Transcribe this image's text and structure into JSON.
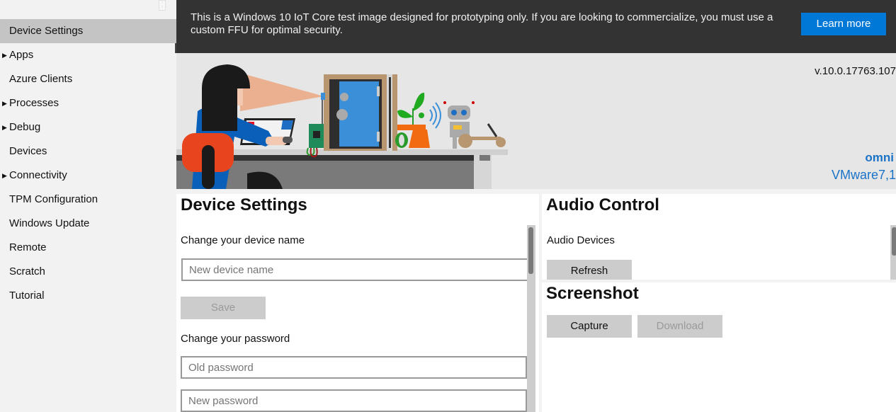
{
  "sidebar": {
    "collapse_icon": "grip-icon",
    "items": [
      {
        "label": "Device Settings",
        "active": true,
        "expandable": false
      },
      {
        "label": "Apps",
        "active": false,
        "expandable": true
      },
      {
        "label": "Azure Clients",
        "active": false,
        "expandable": false
      },
      {
        "label": "Processes",
        "active": false,
        "expandable": true
      },
      {
        "label": "Debug",
        "active": false,
        "expandable": true
      },
      {
        "label": "Devices",
        "active": false,
        "expandable": false
      },
      {
        "label": "Connectivity",
        "active": false,
        "expandable": true
      },
      {
        "label": "TPM Configuration",
        "active": false,
        "expandable": false
      },
      {
        "label": "Windows Update",
        "active": false,
        "expandable": false
      },
      {
        "label": "Remote",
        "active": false,
        "expandable": false
      },
      {
        "label": "Scratch",
        "active": false,
        "expandable": false
      },
      {
        "label": "Tutorial",
        "active": false,
        "expandable": false
      }
    ],
    "expand_glyph": "▶"
  },
  "banner": {
    "message": "This is a Windows 10 IoT Core test image designed for prototyping only. If you are looking to commercialize, you must use a custom FFU for optimal security.",
    "learn_more_label": "Learn more",
    "accent_color": "#0078d7"
  },
  "hero": {
    "version": "v.10.0.17763.107",
    "device_name": "omni",
    "device_model": "VMware7,1"
  },
  "device_settings": {
    "title": "Device Settings",
    "change_name_label": "Change your device name",
    "device_name_placeholder": "New device name",
    "save_label": "Save",
    "change_password_label": "Change your password",
    "old_password_placeholder": "Old password",
    "new_password_placeholder": "New password"
  },
  "audio_control": {
    "title": "Audio Control",
    "devices_label": "Audio Devices",
    "refresh_label": "Refresh"
  },
  "screenshot": {
    "title": "Screenshot",
    "capture_label": "Capture",
    "download_label": "Download"
  }
}
